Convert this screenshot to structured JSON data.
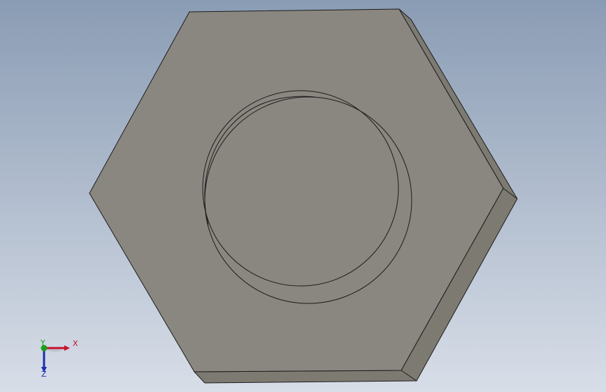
{
  "viewport": {
    "background_top": "#8a9cb4",
    "background_bottom": "#d8dee8",
    "part_face_color": "#8a8780",
    "part_side_color": "#7d7a72",
    "edge_color": "#1c1c1c"
  },
  "triad": {
    "x_label": "X",
    "y_label": "Y",
    "z_label": "Z",
    "x_color": "#c8102e",
    "y_color": "#1aa01a",
    "z_color": "#1a2fb0"
  }
}
